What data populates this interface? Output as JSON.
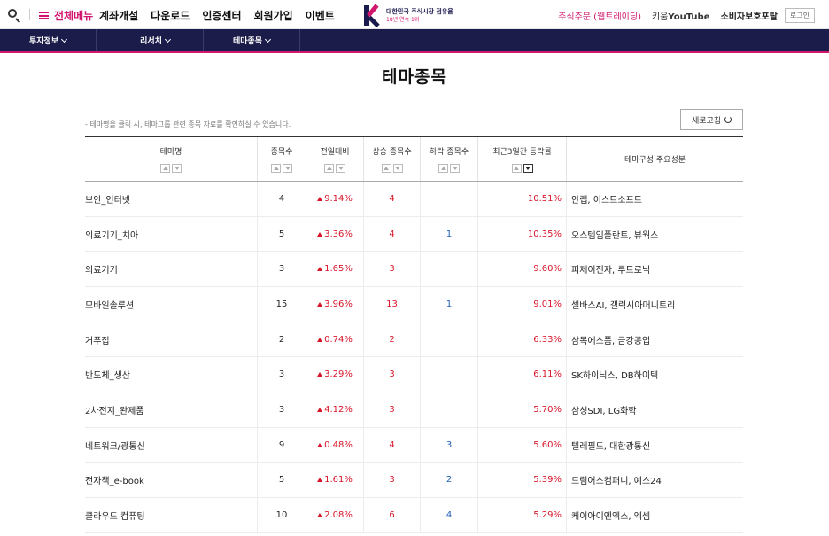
{
  "header": {
    "menu_label": "전체메뉴",
    "gnb": [
      "계좌개설",
      "다운로드",
      "인증센터",
      "회원가입",
      "이벤트"
    ],
    "logo_line1": "대한민국 주식시장 점유율",
    "logo_line2": "18년 연속 1위",
    "order_link": "주식주문 (웹트레이딩)",
    "youtube_prefix": "키움",
    "youtube_brand": "YouTube",
    "portal_link": "소비자보호포탈",
    "login_label": "로그인"
  },
  "subnav": [
    {
      "label": "투자정보"
    },
    {
      "label": "리서치"
    },
    {
      "label": "테마종목"
    }
  ],
  "page_title": "테마종목",
  "guide_text": "- 테마명을 클릭 시, 테마그룹 관련 종목 자료를 확인하실 수 있습니다.",
  "refresh_label": "새로고침",
  "table": {
    "headers": [
      "테마명",
      "종목수",
      "전일대비",
      "상승 종목수",
      "하락 종목수",
      "최근3일간 등락률",
      "테마구성 주요성분"
    ],
    "rows": [
      {
        "name": "보안_인터넷",
        "count": "4",
        "change": "9.14%",
        "up": "4",
        "down": "",
        "r3": "10.51%",
        "comp": "안랩, 이스트소프트"
      },
      {
        "name": "의료기기_치아",
        "count": "5",
        "change": "3.36%",
        "up": "4",
        "down": "1",
        "r3": "10.35%",
        "comp": "오스템임플란트, 뷰웍스"
      },
      {
        "name": "의료기기",
        "count": "3",
        "change": "1.65%",
        "up": "3",
        "down": "",
        "r3": "9.60%",
        "comp": "피제이전자, 루트로닉"
      },
      {
        "name": "모바일솔루션",
        "count": "15",
        "change": "3.96%",
        "up": "13",
        "down": "1",
        "r3": "9.01%",
        "comp": "셀바스AI, 갤럭시아머니트리"
      },
      {
        "name": "거푸집",
        "count": "2",
        "change": "0.74%",
        "up": "2",
        "down": "",
        "r3": "6.33%",
        "comp": "삼목에스폼, 금강공업"
      },
      {
        "name": "반도체_생산",
        "count": "3",
        "change": "3.29%",
        "up": "3",
        "down": "",
        "r3": "6.11%",
        "comp": "SK하이닉스, DB하이텍"
      },
      {
        "name": "2차전지_완제품",
        "count": "3",
        "change": "4.12%",
        "up": "3",
        "down": "",
        "r3": "5.70%",
        "comp": "삼성SDI, LG화학"
      },
      {
        "name": "네트워크/광통신",
        "count": "9",
        "change": "0.48%",
        "up": "4",
        "down": "3",
        "r3": "5.60%",
        "comp": "텔레필드, 대한광통신"
      },
      {
        "name": "전자책_e-book",
        "count": "5",
        "change": "1.61%",
        "up": "3",
        "down": "2",
        "r3": "5.39%",
        "comp": "드림어스컴퍼니, 예스24"
      },
      {
        "name": "클라우드 컴퓨팅",
        "count": "10",
        "change": "2.08%",
        "up": "6",
        "down": "4",
        "r3": "5.29%",
        "comp": "케이아이엔엑스, 엑셈"
      }
    ]
  },
  "colors": {
    "accent": "#d1166e",
    "navy": "#1c1c4a",
    "up_red": "#d8152a",
    "down_blue": "#1f5fb8"
  }
}
